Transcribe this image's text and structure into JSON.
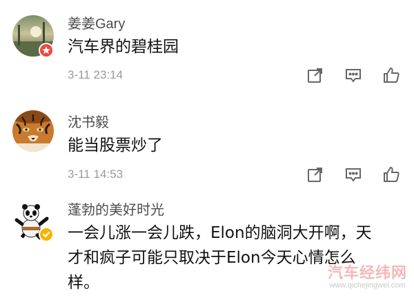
{
  "comments": [
    {
      "author": "姜姜Gary",
      "text": "汽车界的碧桂园",
      "time": "3-11 23:14",
      "avatar_icon": "landscape-sunset-avatar",
      "badge_icon": "star-badge-red"
    },
    {
      "author": "沈书毅",
      "text": "能当股票炒了",
      "time": "3-11 14:53",
      "avatar_icon": "tiger-avatar"
    },
    {
      "author": "蓬勃的美好时光",
      "text_lines": [
        "一会儿涨一会儿跌，Elon的脑洞大开啊，天",
        "才和疯子可能只取决于Elon今天心情怎么",
        "样。"
      ],
      "avatar_icon": "kung-fu-panda-avatar",
      "badge_icon": "verified-badge-yellow"
    }
  ],
  "actions": {
    "share_icon": "share-icon",
    "reply_icon": "comment-icon",
    "like_icon": "thumbs-up-icon"
  },
  "watermark": {
    "brand": "汽车经纬网",
    "url": "www.qichejingwei.com"
  },
  "colors": {
    "author": "#4d4d4d",
    "time": "#9a9a9a",
    "badge_red": "#e84a3d",
    "badge_yellow": "#f5b400"
  }
}
